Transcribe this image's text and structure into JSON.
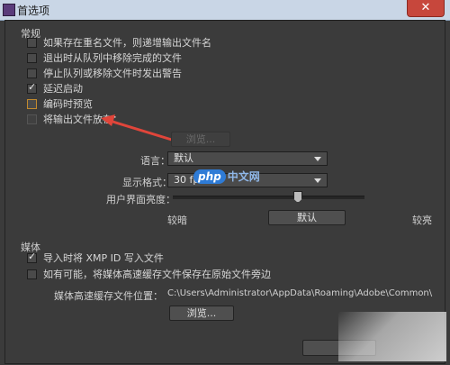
{
  "window": {
    "title": "首选项",
    "close": "✕"
  },
  "general": {
    "header": "常规",
    "options": [
      {
        "label": "如果存在重名文件，则递增输出文件名",
        "checked": false
      },
      {
        "label": "退出时从队列中移除完成的文件",
        "checked": false
      },
      {
        "label": "停止队列或移除文件时发出警告",
        "checked": false
      },
      {
        "label": "延迟启动",
        "checked": true
      },
      {
        "label": "编码时预览",
        "checked": false
      },
      {
        "label": "将输出文件放在：",
        "checked": false
      }
    ],
    "browse_disabled": "浏览...",
    "language_label": "语言：",
    "language_value": "默认",
    "display_format_label": "显示格式：",
    "display_format_value": "30 fps",
    "ui_brightness_label": "用户界面亮度：",
    "brightness_dark": "较暗",
    "brightness_default": "默认",
    "brightness_light": "较亮",
    "brightness_level": 0.63
  },
  "media": {
    "header": "媒体",
    "options": [
      {
        "label": "导入时将 XMP ID 写入文件",
        "checked": true
      },
      {
        "label": "如有可能，将媒体高速缓存文件保存在原始文件旁边",
        "checked": false
      }
    ],
    "cache_label": "媒体高速缓存文件位置：",
    "cache_path": "C:\\Users\\Administrator\\AppData\\Roaming\\Adobe\\Common\\",
    "browse": "浏览..."
  },
  "watermark": {
    "logo": "php",
    "text": "中文网"
  },
  "colors": {
    "accent_arrow": "#e0453a",
    "background": "#3b3b3b",
    "titlebar": "#c9d6e6"
  }
}
